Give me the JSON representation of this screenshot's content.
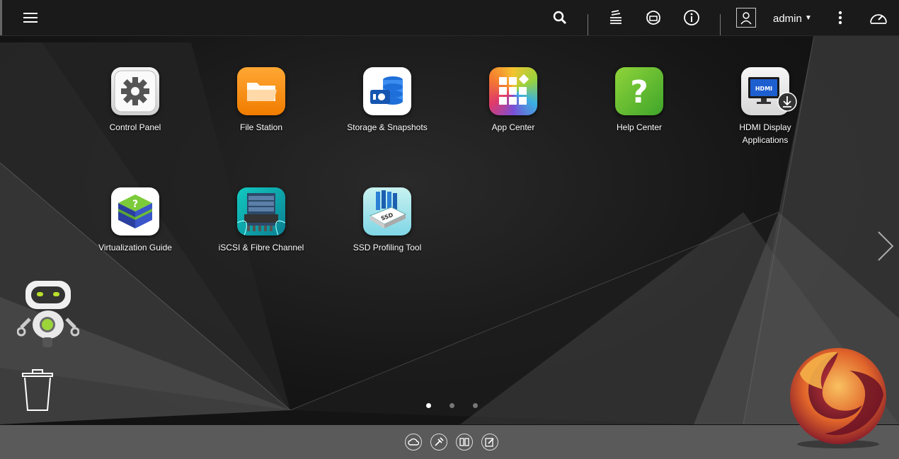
{
  "topbar": {
    "menu_icon": "hamburger-menu-icon",
    "search_icon": "search-icon",
    "tasks_icon": "background-tasks-icon",
    "external_devices_icon": "external-device-icon",
    "notifications_icon": "info-icon",
    "user_icon": "user-icon",
    "username": "admin",
    "options_icon": "more-vertical-icon",
    "dashboard_icon": "dashboard-gauge-icon"
  },
  "apps": [
    {
      "label": "Control Panel",
      "icon": "gear-icon"
    },
    {
      "label": "File Station",
      "icon": "folder-icon"
    },
    {
      "label": "Storage & Snapshots",
      "icon": "storage-icon"
    },
    {
      "label": "App Center",
      "icon": "app-grid-icon"
    },
    {
      "label": "Help Center",
      "icon": "question-icon"
    },
    {
      "label": "HDMI Display Applications",
      "label_line1": "HDMI Display",
      "label_line2": "Applications",
      "icon": "hdmi-monitor-icon"
    },
    {
      "label": "Virtualization Guide",
      "icon": "virtualization-cube-icon"
    },
    {
      "label": "iSCSI & Fibre Channel",
      "icon": "server-rack-icon"
    },
    {
      "label": "SSD Profiling Tool",
      "icon": "ssd-icon"
    }
  ],
  "pagination": {
    "pages": 3,
    "current": 1
  },
  "desktop": {
    "assistant_icon": "robot-assistant-icon",
    "trash_icon": "trash-icon",
    "next_page_icon": "chevron-right-icon"
  },
  "bottombar": {
    "icons": [
      "cloud-link-icon",
      "tools-icon",
      "book-icon",
      "feedback-icon"
    ]
  },
  "colors": {
    "topbar_bg": "#1a1a1a",
    "bottombar_bg": "#5a5a5a",
    "file_station": "#f7931e",
    "help_center": "#5cbf2a"
  }
}
